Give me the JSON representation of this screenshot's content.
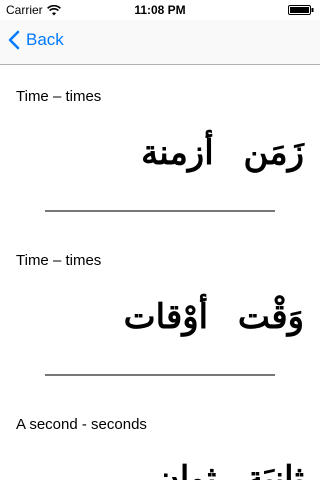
{
  "status_bar": {
    "carrier": "Carrier",
    "time": "11:08 PM"
  },
  "nav": {
    "back_label": "Back"
  },
  "entries": [
    {
      "english": "Time – times",
      "arabic": "زَمَن  أزمنة"
    },
    {
      "english": "Time – times",
      "arabic": "وَقْت  أوْقات"
    },
    {
      "english": "A second - seconds",
      "arabic": "ثانِيَة  ثوانٍ"
    }
  ]
}
